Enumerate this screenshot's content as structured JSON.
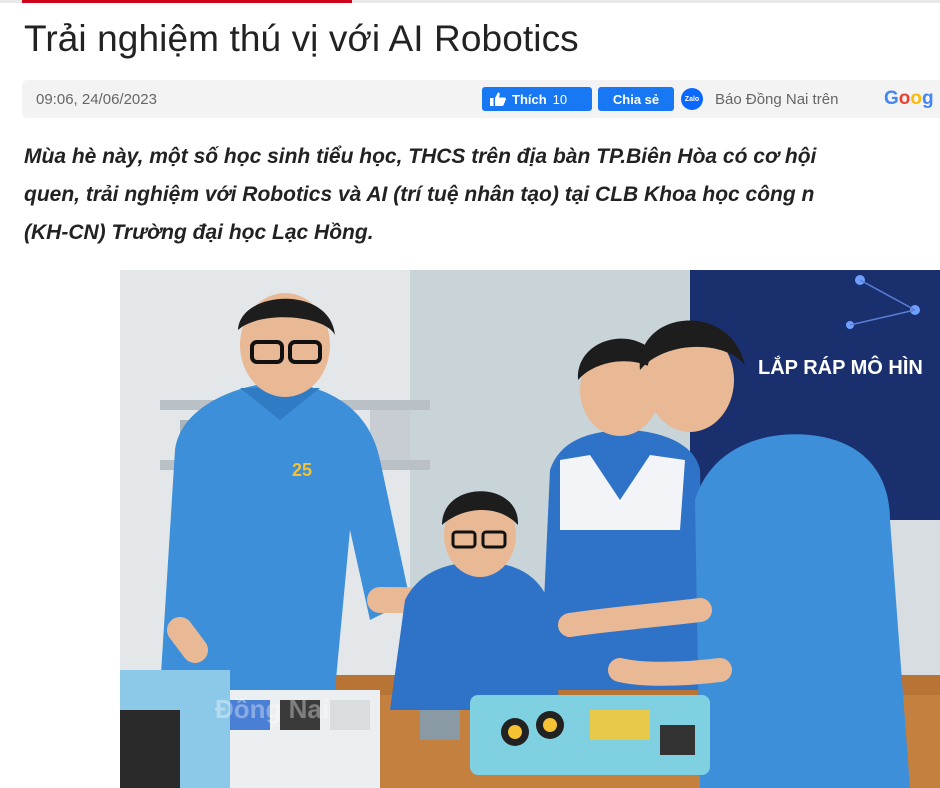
{
  "article": {
    "title": "Trải nghiệm thú vị với AI Robotics",
    "meta": {
      "time": "09:06, 24/06/2023",
      "like_label": "Thích",
      "like_count": "10",
      "share_label": "Chia sẻ",
      "zalo_label": "Zalo",
      "source_text": "Báo Đồng Nai trên",
      "google": {
        "g1": "G",
        "g2": "o",
        "g3": "o",
        "g4": "g"
      }
    },
    "sapo_lines": [
      "Mùa hè này, một số học sinh tiểu học, THCS trên địa bàn TP.Biên Hòa có cơ hội",
      "quen, trải nghiệm với Robotics và AI (trí tuệ nhân tạo) tại CLB Khoa học công n",
      "(KH-CN) Trường đại học Lạc Hồng."
    ],
    "photo": {
      "banner_text": "LẮP RÁP MÔ HÌN",
      "logo_number": "25",
      "watermark": "Đồng Nai"
    }
  },
  "colors": {
    "accent_red": "#d0021b",
    "facebook_blue": "#1877f2",
    "zalo_blue": "#0a68fe",
    "shirt_blue": "#3d8fd9",
    "banner_navy": "#1a2f6e"
  },
  "icons": [
    "thumbs-up-icon",
    "zalo-icon",
    "google-logo"
  ]
}
